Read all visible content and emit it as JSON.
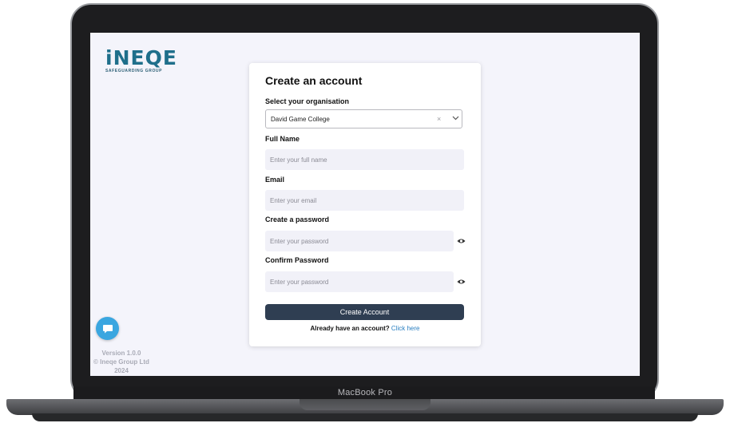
{
  "device": {
    "model_label": "MacBook Pro"
  },
  "brand": {
    "logo_text": "iNEQE",
    "tagline": "SAFEGUARDING GROUP"
  },
  "footer": {
    "version": "Version 1.0.0",
    "copyright": "© Ineqe Group Ltd 2024"
  },
  "form": {
    "title": "Create an account",
    "organisation": {
      "label": "Select your organisation",
      "selected": "David Game College",
      "clear_glyph": "×"
    },
    "full_name": {
      "label": "Full Name",
      "placeholder": "Enter your full name"
    },
    "email": {
      "label": "Email",
      "placeholder": "Enter your email"
    },
    "password": {
      "label": "Create a password",
      "placeholder": "Enter your password"
    },
    "confirm_password": {
      "label": "Confirm Password",
      "placeholder": "Enter your password"
    },
    "submit_label": "Create Account",
    "signin_prompt": "Already have an account?",
    "signin_link": "Click here"
  },
  "colors": {
    "accent": "#2f3e52",
    "link": "#2a7fc1",
    "chat": "#3aa6e0",
    "input_bg": "#f1f1f8"
  },
  "icons": {
    "chat": "chat-bubble-icon",
    "eye": "eye-icon",
    "chevron": "chevron-down-icon",
    "clear": "clear-icon"
  }
}
